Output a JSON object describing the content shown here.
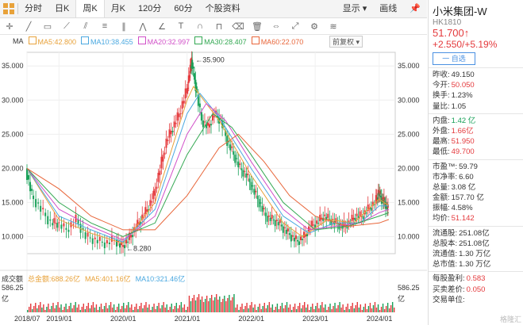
{
  "topbar": {
    "tabs": [
      "分时",
      "日K",
      "周K",
      "月K",
      "120分",
      "60分",
      "个股资料"
    ],
    "active_tab": 2,
    "display_label": "显示 ▾",
    "draw_label": "画线"
  },
  "legend": {
    "ma": "MA",
    "items": [
      {
        "label": "MA5:42.800",
        "color": "#e8a23a"
      },
      {
        "label": "MA10:38.455",
        "color": "#4aa8e0"
      },
      {
        "label": "MA20:32.997",
        "color": "#d14fc8"
      },
      {
        "label": "MA30:28.407",
        "color": "#33a852"
      },
      {
        "label": "MA60:22.070",
        "color": "#e8663a"
      }
    ],
    "adjust": "前复权 ▾"
  },
  "chart_data": {
    "type": "candlestick",
    "ylim": [
      7.5,
      37
    ],
    "yticks": [
      "35.000",
      "30.000",
      "25.000",
      "20.000",
      "15.000",
      "10.000"
    ],
    "ytick_values": [
      35,
      30,
      25,
      20,
      15,
      10
    ],
    "xticks": [
      "2018/07",
      "2019/01",
      "2020/01",
      "2021/01",
      "2022/01",
      "2023/01",
      "2024/01"
    ],
    "xtick_values": [
      2018.5,
      2019.0,
      2020.0,
      2021.0,
      2022.0,
      2023.0,
      2024.0
    ],
    "xlim": [
      2018.5,
      2024.25
    ],
    "annotations": [
      {
        "x": 2021.08,
        "y": 35.9,
        "text": "35.900"
      },
      {
        "x": 2020.0,
        "y": 8.28,
        "text": "8.280"
      }
    ],
    "series": [
      {
        "name": "price",
        "values": [
          [
            2018.5,
            20
          ],
          [
            2018.6,
            16
          ],
          [
            2018.75,
            14
          ],
          [
            2018.9,
            12
          ],
          [
            2019.0,
            12
          ],
          [
            2019.15,
            11
          ],
          [
            2019.3,
            12.5
          ],
          [
            2019.45,
            10
          ],
          [
            2019.6,
            9.5
          ],
          [
            2019.75,
            9
          ],
          [
            2019.9,
            9.5
          ],
          [
            2020.0,
            8.5
          ],
          [
            2020.1,
            9.5
          ],
          [
            2020.2,
            11
          ],
          [
            2020.3,
            12.5
          ],
          [
            2020.4,
            14
          ],
          [
            2020.5,
            16
          ],
          [
            2020.6,
            20
          ],
          [
            2020.7,
            24
          ],
          [
            2020.8,
            26
          ],
          [
            2020.9,
            28
          ],
          [
            2021.0,
            31
          ],
          [
            2021.05,
            34
          ],
          [
            2021.08,
            35.9
          ],
          [
            2021.15,
            32
          ],
          [
            2021.25,
            27
          ],
          [
            2021.35,
            26
          ],
          [
            2021.45,
            28
          ],
          [
            2021.55,
            27
          ],
          [
            2021.65,
            24
          ],
          [
            2021.75,
            22
          ],
          [
            2021.85,
            20
          ],
          [
            2021.95,
            19
          ],
          [
            2022.05,
            17
          ],
          [
            2022.15,
            15
          ],
          [
            2022.25,
            13
          ],
          [
            2022.35,
            12.5
          ],
          [
            2022.45,
            12
          ],
          [
            2022.55,
            11
          ],
          [
            2022.65,
            10
          ],
          [
            2022.75,
            9.3
          ],
          [
            2022.85,
            10
          ],
          [
            2022.95,
            11.5
          ],
          [
            2023.05,
            12
          ],
          [
            2023.15,
            13
          ],
          [
            2023.25,
            12.5
          ],
          [
            2023.35,
            12
          ],
          [
            2023.45,
            11.5
          ],
          [
            2023.55,
            12
          ],
          [
            2023.65,
            13
          ],
          [
            2023.75,
            13
          ],
          [
            2023.85,
            14
          ],
          [
            2023.95,
            15
          ],
          [
            2024.0,
            16.5
          ],
          [
            2024.05,
            15.5
          ],
          [
            2024.1,
            15
          ],
          [
            2024.15,
            14
          ]
        ]
      }
    ],
    "ma_lines": [
      {
        "name": "MA5",
        "values": [
          [
            2018.5,
            20
          ],
          [
            2019.0,
            12.5
          ],
          [
            2019.5,
            10.5
          ],
          [
            2020.0,
            9
          ],
          [
            2020.5,
            15
          ],
          [
            2021.0,
            30
          ],
          [
            2021.1,
            32
          ],
          [
            2021.5,
            27
          ],
          [
            2022.0,
            19
          ],
          [
            2022.5,
            12
          ],
          [
            2022.8,
            10
          ],
          [
            2023.2,
            12.5
          ],
          [
            2023.6,
            12
          ],
          [
            2024.0,
            15.5
          ],
          [
            2024.15,
            14.5
          ]
        ]
      },
      {
        "name": "MA10",
        "values": [
          [
            2018.5,
            20
          ],
          [
            2019.0,
            13
          ],
          [
            2019.5,
            11
          ],
          [
            2020.0,
            9.2
          ],
          [
            2020.5,
            14
          ],
          [
            2021.0,
            28
          ],
          [
            2021.2,
            31
          ],
          [
            2021.5,
            27.5
          ],
          [
            2022.0,
            20
          ],
          [
            2022.5,
            13
          ],
          [
            2022.9,
            10.5
          ],
          [
            2023.3,
            12
          ],
          [
            2023.7,
            12
          ],
          [
            2024.0,
            14.5
          ],
          [
            2024.15,
            14.5
          ]
        ]
      },
      {
        "name": "MA20",
        "values": [
          [
            2018.5,
            20
          ],
          [
            2019.0,
            14
          ],
          [
            2019.5,
            11.5
          ],
          [
            2020.0,
            9.5
          ],
          [
            2020.5,
            13
          ],
          [
            2021.0,
            25
          ],
          [
            2021.3,
            29.5
          ],
          [
            2021.6,
            27
          ],
          [
            2022.0,
            21
          ],
          [
            2022.5,
            14
          ],
          [
            2022.9,
            11
          ],
          [
            2023.3,
            11.5
          ],
          [
            2023.7,
            12
          ],
          [
            2024.0,
            13.5
          ],
          [
            2024.15,
            14
          ]
        ]
      },
      {
        "name": "MA30",
        "values": [
          [
            2018.5,
            20
          ],
          [
            2019.0,
            15
          ],
          [
            2019.5,
            12
          ],
          [
            2020.0,
            10
          ],
          [
            2020.5,
            12
          ],
          [
            2021.0,
            22
          ],
          [
            2021.4,
            28
          ],
          [
            2021.7,
            26
          ],
          [
            2022.0,
            22
          ],
          [
            2022.5,
            15
          ],
          [
            2023.0,
            11
          ],
          [
            2023.5,
            11.5
          ],
          [
            2024.0,
            13
          ],
          [
            2024.15,
            13.5
          ]
        ]
      },
      {
        "name": "MA60",
        "values": [
          [
            2018.5,
            20
          ],
          [
            2019.0,
            17
          ],
          [
            2019.5,
            13
          ],
          [
            2020.0,
            11
          ],
          [
            2020.5,
            11
          ],
          [
            2021.0,
            16
          ],
          [
            2021.5,
            23
          ],
          [
            2021.8,
            25
          ],
          [
            2022.2,
            21
          ],
          [
            2022.6,
            16
          ],
          [
            2023.0,
            13
          ],
          [
            2023.5,
            11.5
          ],
          [
            2024.0,
            12
          ],
          [
            2024.15,
            12.5
          ]
        ]
      }
    ],
    "volume": {
      "label": "成交额",
      "total": "总金额:688.26亿",
      "ma5": "MA5:401.16亿",
      "ma10": "MA10:321.46亿",
      "ymax_label": "586.25",
      "unit": "亿"
    }
  },
  "side": {
    "name": "小米集团-W",
    "code": "HK1810",
    "price": "51.700↑",
    "change": "+2.550/+5.19%",
    "fav": "一 自选",
    "rows": [
      {
        "k": "昨收:",
        "v": "49.150",
        "c": "#333"
      },
      {
        "k": "今开:",
        "v": "50.050",
        "c": "#e4393c"
      },
      {
        "k": "换手:",
        "v": "1.23%",
        "c": "#333"
      },
      {
        "k": "量比:",
        "v": "1.05",
        "c": "#333"
      },
      {
        "k": "内盘:",
        "v": "1.42 亿",
        "c": "#18a058"
      },
      {
        "k": "外盘:",
        "v": "1.66亿",
        "c": "#e4393c"
      },
      {
        "k": "最高:",
        "v": "51.950",
        "c": "#e4393c"
      },
      {
        "k": "最低:",
        "v": "49.700",
        "c": "#e4393c"
      },
      {
        "k": "市盈™:",
        "v": "59.79",
        "c": "#333"
      },
      {
        "k": "市净率:",
        "v": "6.60",
        "c": "#333"
      },
      {
        "k": "总量:",
        "v": "3.08 亿",
        "c": "#333"
      },
      {
        "k": "金额:",
        "v": "157.70 亿",
        "c": "#333"
      },
      {
        "k": "振幅:",
        "v": "4.58%",
        "c": "#333"
      },
      {
        "k": "均价:",
        "v": "51.142",
        "c": "#e4393c"
      },
      {
        "k": "流通股:",
        "v": "251.08亿",
        "c": "#333"
      },
      {
        "k": "总股本:",
        "v": "251.08亿",
        "c": "#333"
      },
      {
        "k": "流通值:",
        "v": "1.30 万亿",
        "c": "#333"
      },
      {
        "k": "总市值:",
        "v": "1.30 万亿",
        "c": "#333"
      },
      {
        "k": "每股盈利:",
        "v": "0.583",
        "c": "#e4393c"
      },
      {
        "k": "买卖差价:",
        "v": "0.050",
        "c": "#e4393c"
      },
      {
        "k": "交易单位:",
        "v": "",
        "c": "#333"
      }
    ]
  },
  "watermark": "格隆汇"
}
